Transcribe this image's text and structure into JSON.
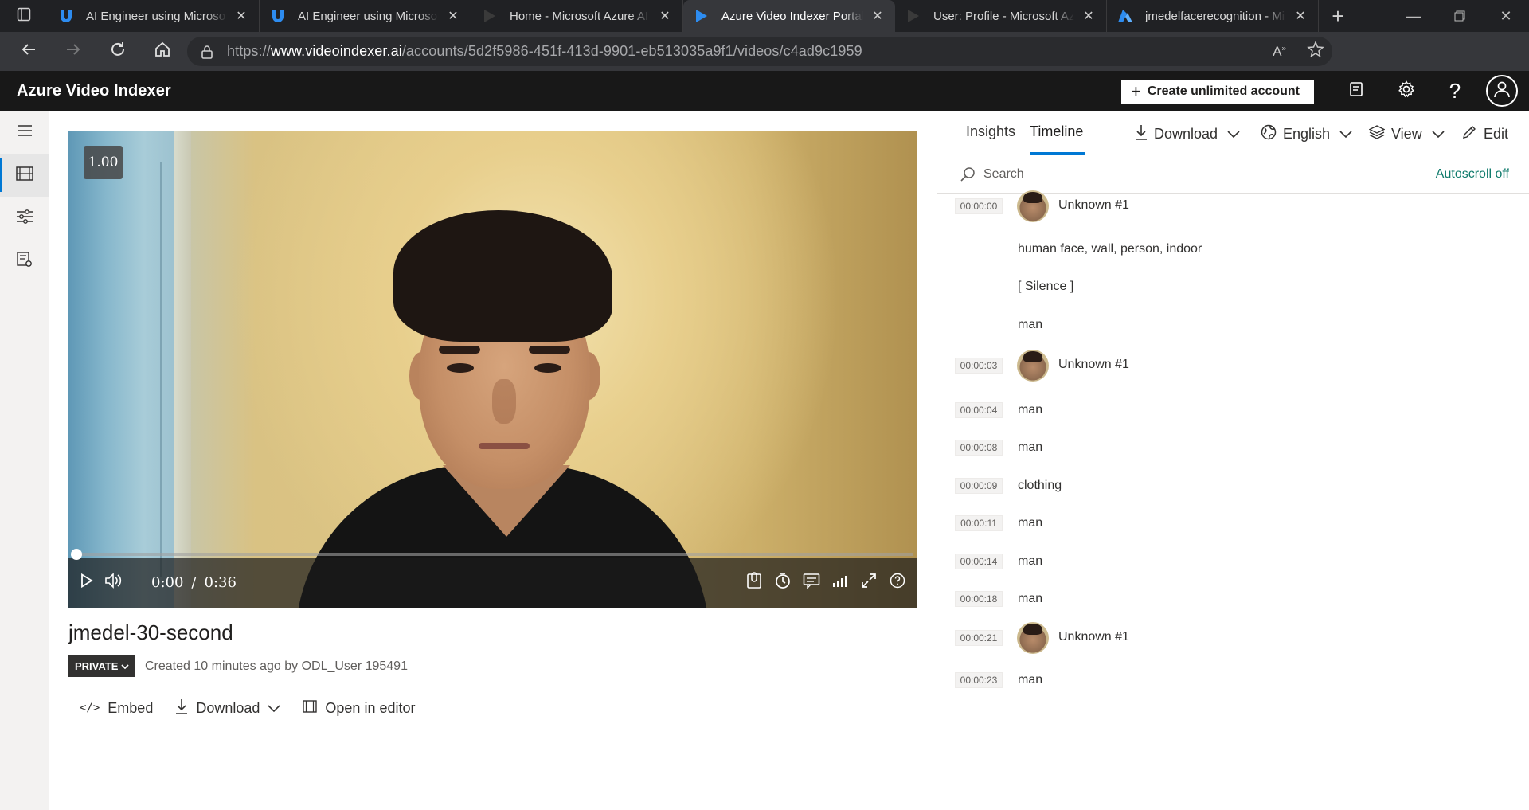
{
  "browser": {
    "tabs": [
      {
        "title": "AI Engineer using Microsoft",
        "favicon": "u-logo-icon",
        "active": false
      },
      {
        "title": "AI Engineer using Microsoft",
        "favicon": "u-logo-icon",
        "active": false
      },
      {
        "title": "Home - Microsoft Azure AI",
        "favicon": "azure-play-icon",
        "active": false
      },
      {
        "title": "Azure Video Indexer Portal",
        "favicon": "azure-play-icon",
        "active": true
      },
      {
        "title": "User: Profile - Microsoft Azu",
        "favicon": "azure-play-icon",
        "active": false
      },
      {
        "title": "jmedelfacerecognition - Mi",
        "favicon": "azure-a-icon",
        "active": false
      }
    ],
    "url": {
      "prefix": "https://",
      "host": "www.videoindexer.ai",
      "path": "/accounts/5d2f5986-451f-413d-9901-eb513035a9f1/videos/c4ad9c1959"
    }
  },
  "app": {
    "title": "Azure Video Indexer",
    "create_label": "Create unlimited account"
  },
  "player": {
    "speed": "1.00",
    "current_time": "0:00",
    "separator": "/",
    "duration": "0:36",
    "progress_fraction": 0.0
  },
  "video": {
    "title": "jmedel-30-second",
    "privacy": "PRIVATE",
    "created": "Created 10 minutes ago by ODL_User 195491",
    "actions": {
      "embed": "Embed",
      "download": "Download",
      "open_editor": "Open in editor"
    }
  },
  "panel": {
    "tabs": {
      "insights": "Insights",
      "timeline": "Timeline"
    },
    "active_tab": "Timeline",
    "download": "Download",
    "language": "English",
    "view": "View",
    "edit": "Edit",
    "search_placeholder": "Search",
    "autoscroll": "Autoscroll off",
    "timeline": [
      {
        "time": "00:00:00",
        "text": "Unknown #1",
        "face": true
      },
      {
        "time": "",
        "text": "human face, wall, person, indoor",
        "face": false
      },
      {
        "time": "",
        "text": "[ Silence ]",
        "face": false
      },
      {
        "time": "",
        "text": "man",
        "face": false
      },
      {
        "time": "00:00:03",
        "text": "Unknown #1",
        "face": true
      },
      {
        "time": "00:00:04",
        "text": "man",
        "face": false
      },
      {
        "time": "00:00:08",
        "text": "man",
        "face": false
      },
      {
        "time": "00:00:09",
        "text": "clothing",
        "face": false
      },
      {
        "time": "00:00:11",
        "text": "man",
        "face": false
      },
      {
        "time": "00:00:14",
        "text": "man",
        "face": false
      },
      {
        "time": "00:00:18",
        "text": "man",
        "face": false
      },
      {
        "time": "00:00:21",
        "text": "Unknown #1",
        "face": true
      },
      {
        "time": "00:00:23",
        "text": "man",
        "face": false
      }
    ]
  },
  "colors": {
    "accent": "#0078d4",
    "header_bg": "#181818",
    "autoscroll": "#0f7b6c"
  }
}
